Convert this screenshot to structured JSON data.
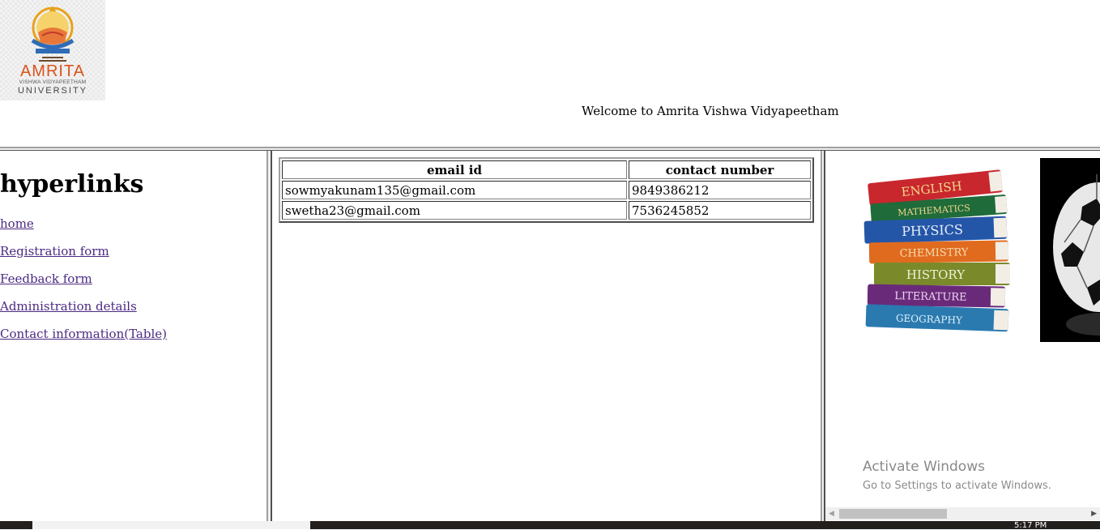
{
  "header": {
    "logo_brand": "AMRITA",
    "logo_line2": "VISHWA VIDYAPEETHAM",
    "logo_line3": "UNIVERSITY",
    "welcome_text": "Welcome to Amrita Vishwa Vidyapeetham"
  },
  "sidebar": {
    "heading": "hyperlinks",
    "links": [
      {
        "label": "home"
      },
      {
        "label": "Registration form"
      },
      {
        "label": "Feedback form"
      },
      {
        "label": "Administration details"
      },
      {
        "label": "Contact information(Table)"
      }
    ]
  },
  "table": {
    "headers": [
      "email id",
      "contact number"
    ],
    "rows": [
      [
        "sowmyakunam135@gmail.com",
        "9849386212"
      ],
      [
        "swetha23@gmail.com",
        "7536245852"
      ]
    ]
  },
  "books": [
    "ENGLISH",
    "MATHEMATICS",
    "PHYSICS",
    "CHEMISTRY",
    "HISTORY",
    "LITERATURE",
    "GEOGRAPHY"
  ],
  "watermark": {
    "title": "Activate Windows",
    "subtitle": "Go to Settings to activate Windows."
  },
  "taskbar": {
    "clock": "5:17 PM"
  },
  "colors": {
    "link": "#4b2a82",
    "frame_border": "#a0a0a0",
    "logo_accent": "#d9541e",
    "taskbar": "#231f1d"
  }
}
